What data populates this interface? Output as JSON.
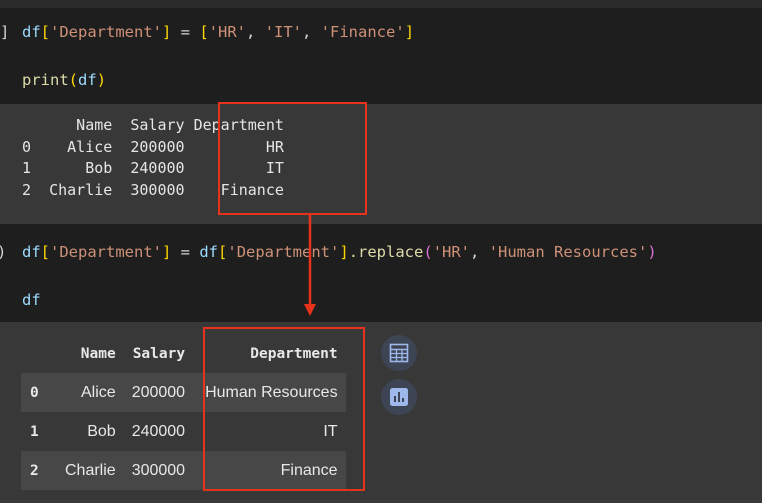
{
  "cell1": {
    "bracket": "]",
    "line1": {
      "var": "df",
      "open": "[",
      "key": "'Department'",
      "close": "]",
      "eq": " = ",
      "lopen": "[",
      "v1": "'HR'",
      "c1": ", ",
      "v2": "'IT'",
      "c2": ", ",
      "v3": "'Finance'",
      "lclose": "]"
    },
    "line2": {
      "fn": "print",
      "open": "(",
      "arg": "df",
      "close": ")"
    }
  },
  "output1": {
    "text": "      Name  Salary Department\n0    Alice  200000         HR\n1      Bob  240000         IT\n2  Charlie  300000    Finance"
  },
  "cell2": {
    "bracket": ")",
    "line1": {
      "var": "df",
      "open": "[",
      "key": "'Department'",
      "close": "]",
      "eq": " = ",
      "var2": "df",
      "open2": "[",
      "key2": "'Department'",
      "close2": "]",
      "method": ".replace",
      "popen": "(",
      "a1": "'HR'",
      "comma": ", ",
      "a2": "'Human Resources'",
      "pclose": ")"
    },
    "line2": "df"
  },
  "dataframe": {
    "columns": [
      "Name",
      "Salary",
      "Department"
    ],
    "rows": [
      {
        "index": "0",
        "name": "Alice",
        "salary": "200000",
        "department": "Human Resources"
      },
      {
        "index": "1",
        "name": "Bob",
        "salary": "240000",
        "department": "IT"
      },
      {
        "index": "2",
        "name": "Charlie",
        "salary": "300000",
        "department": "Finance"
      }
    ]
  },
  "icons": [
    "table-view-icon",
    "chart-suggest-icon"
  ],
  "colors": {
    "highlight": "#e8331c",
    "code_bg": "#1e1e1e",
    "output_bg": "#383838"
  }
}
